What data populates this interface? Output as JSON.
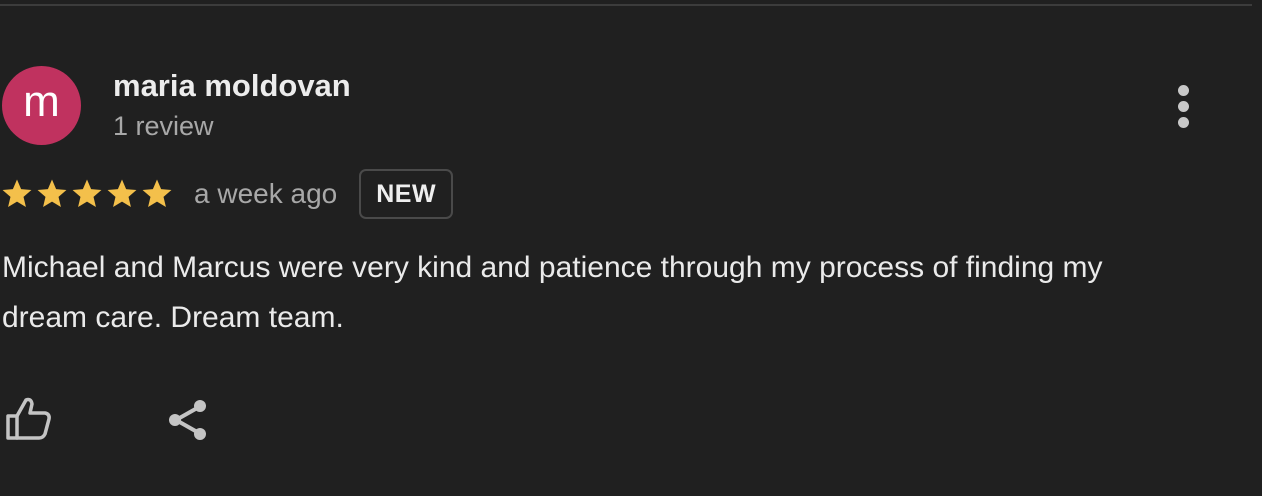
{
  "review": {
    "avatar_letter": "m",
    "avatar_color": "#c0325f",
    "reviewer_name": "maria moldovan",
    "review_count": "1 review",
    "rating": 5,
    "rating_max": 5,
    "star_color": "#f4c04b",
    "time_ago": "a week ago",
    "badge": "NEW",
    "text": "Michael and Marcus were very kind and patience through my process of finding my dream care. Dream team."
  },
  "icons": {
    "more": "more-vertical-icon",
    "like": "thumbs-up-icon",
    "share": "share-icon",
    "star": "star-icon"
  }
}
